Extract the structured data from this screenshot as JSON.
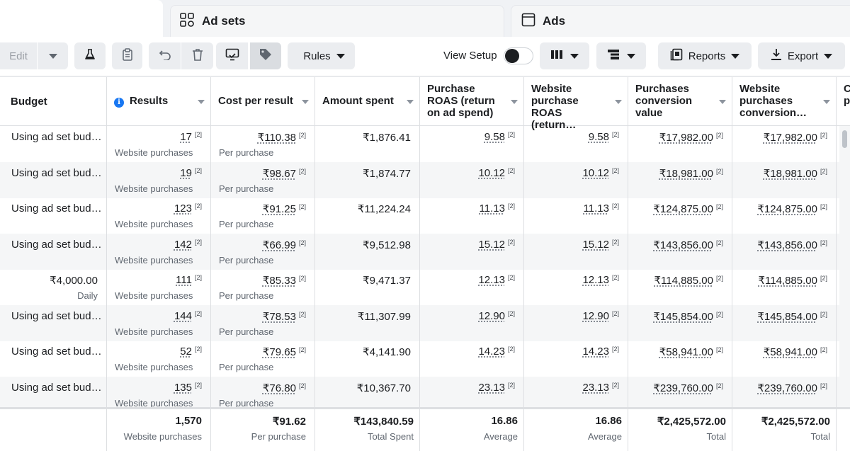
{
  "tabs": [
    {
      "label": "",
      "icon": "blank"
    },
    {
      "label": "Ad sets",
      "icon": "grid-icon"
    },
    {
      "label": "Ads",
      "icon": "ad-window-icon"
    }
  ],
  "toolbar": {
    "edit_label": "Edit",
    "rules_label": "Rules",
    "view_setup_label": "View Setup",
    "reports_label": "Reports",
    "export_label": "Export"
  },
  "columns": [
    {
      "label": "Budget"
    },
    {
      "label": "Results"
    },
    {
      "label": "Cost per result"
    },
    {
      "label": "Amount spent"
    },
    {
      "label": "Purchase ROAS (return on ad spend)",
      "lines": [
        "Purchase",
        "ROAS (return",
        "on ad spend)"
      ]
    },
    {
      "label": "Website purchase ROAS (return…",
      "lines": [
        "Website",
        "purchase",
        "ROAS (return…"
      ]
    },
    {
      "label": "Purchases conversion value",
      "lines": [
        "Purchases",
        "conversion",
        "value"
      ]
    },
    {
      "label": "Website purchases conversion…",
      "lines": [
        "Website",
        "purchases",
        "conversion…"
      ]
    },
    {
      "label": "C p",
      "lines": [
        "C",
        "p"
      ]
    }
  ],
  "attribution_mark": "[2]",
  "rows": [
    {
      "budget": "Using ad set bud…",
      "budget_sub": "",
      "results": "17",
      "results_sub": "Website purchases",
      "cpr": "₹110.38",
      "cpr_sub": "Per purchase",
      "spent": "₹1,876.41",
      "roas": "9.58",
      "web_roas": "9.58",
      "conv_value": "₹17,982.00",
      "web_conv": "₹17,982.00"
    },
    {
      "budget": "Using ad set bud…",
      "budget_sub": "",
      "results": "19",
      "results_sub": "Website purchases",
      "cpr": "₹98.67",
      "cpr_sub": "Per purchase",
      "spent": "₹1,874.77",
      "roas": "10.12",
      "web_roas": "10.12",
      "conv_value": "₹18,981.00",
      "web_conv": "₹18,981.00"
    },
    {
      "budget": "Using ad set bud…",
      "budget_sub": "",
      "results": "123",
      "results_sub": "Website purchases",
      "cpr": "₹91.25",
      "cpr_sub": "Per purchase",
      "spent": "₹11,224.24",
      "roas": "11.13",
      "web_roas": "11.13",
      "conv_value": "₹124,875.00",
      "web_conv": "₹124,875.00"
    },
    {
      "budget": "Using ad set bud…",
      "budget_sub": "",
      "results": "142",
      "results_sub": "Website purchases",
      "cpr": "₹66.99",
      "cpr_sub": "Per purchase",
      "spent": "₹9,512.98",
      "roas": "15.12",
      "web_roas": "15.12",
      "conv_value": "₹143,856.00",
      "web_conv": "₹143,856.00"
    },
    {
      "budget": "₹4,000.00",
      "budget_sub": "Daily",
      "results": "111",
      "results_sub": "Website purchases",
      "cpr": "₹85.33",
      "cpr_sub": "Per purchase",
      "spent": "₹9,471.37",
      "roas": "12.13",
      "web_roas": "12.13",
      "conv_value": "₹114,885.00",
      "web_conv": "₹114,885.00"
    },
    {
      "budget": "Using ad set bud…",
      "budget_sub": "",
      "results": "144",
      "results_sub": "Website purchases",
      "cpr": "₹78.53",
      "cpr_sub": "Per purchase",
      "spent": "₹11,307.99",
      "roas": "12.90",
      "web_roas": "12.90",
      "conv_value": "₹145,854.00",
      "web_conv": "₹145,854.00"
    },
    {
      "budget": "Using ad set bud…",
      "budget_sub": "",
      "results": "52",
      "results_sub": "Website purchases",
      "cpr": "₹79.65",
      "cpr_sub": "Per purchase",
      "spent": "₹4,141.90",
      "roas": "14.23",
      "web_roas": "14.23",
      "conv_value": "₹58,941.00",
      "web_conv": "₹58,941.00"
    },
    {
      "budget": "Using ad set bud…",
      "budget_sub": "",
      "results": "135",
      "results_sub": "Website purchases",
      "cpr": "₹76.80",
      "cpr_sub": "Per purchase",
      "spent": "₹10,367.70",
      "roas": "23.13",
      "web_roas": "23.13",
      "conv_value": "₹239,760.00",
      "web_conv": "₹239,760.00"
    }
  ],
  "totals": {
    "results": "1,570",
    "results_sub": "Website purchases",
    "cpr": "₹91.62",
    "cpr_sub": "Per purchase",
    "spent": "₹143,840.59",
    "spent_sub": "Total Spent",
    "roas": "16.86",
    "roas_sub": "Average",
    "web_roas": "16.86",
    "web_roas_sub": "Average",
    "conv_value": "₹2,425,572.00",
    "conv_value_sub": "Total",
    "web_conv": "₹2,425,572.00",
    "web_conv_sub": "Total"
  }
}
